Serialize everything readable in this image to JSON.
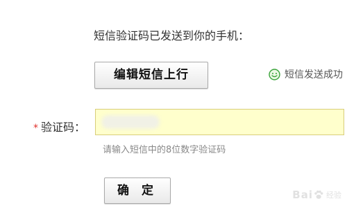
{
  "sms": {
    "notice": "短信验证码已发送到你的手机：",
    "edit_button_label": "编辑短信上行",
    "status_text": "短信发送成功",
    "status_icon": "smile-icon"
  },
  "form": {
    "required_mark": "*",
    "code_label": "验证码：",
    "code_value": "",
    "hint": "请输入短信中的8位数字验证码",
    "confirm_label": "确 定"
  },
  "colors": {
    "input_background": "#ffffcc",
    "input_border": "#d8cd7a",
    "status_icon": "#3aa33a",
    "required_mark": "#e0302b"
  },
  "watermark": {
    "text_left": "Bai",
    "text_right": "经验",
    "icon": "baidu-paw-icon"
  }
}
